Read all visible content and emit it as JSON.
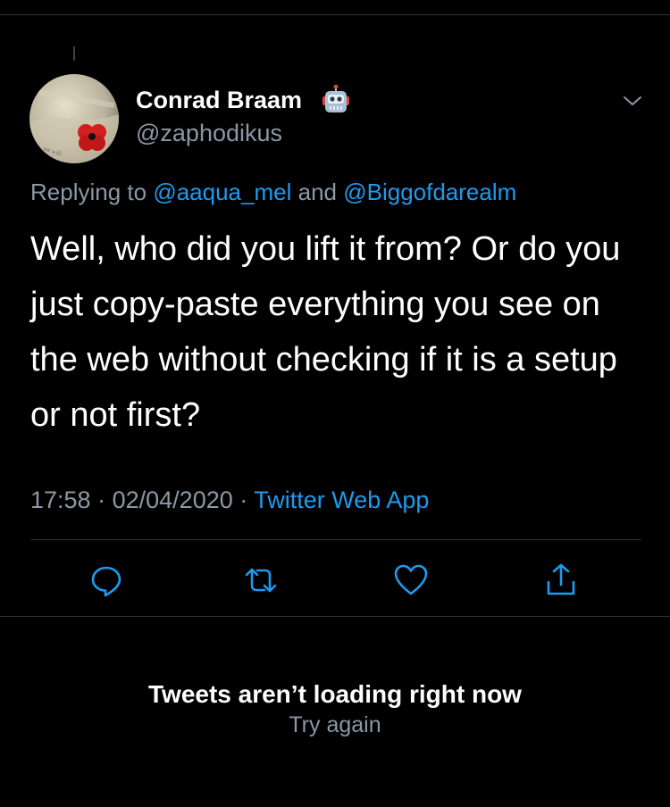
{
  "tweet": {
    "author_name": "Conrad Braam",
    "author_handle": "@zaphodikus",
    "author_badge_icon": "robot-face-icon",
    "menu_icon": "chevron-down-icon",
    "replying_prefix": "Replying to",
    "reply_mentions": [
      "@aaqua_mel",
      "@Biggofdarealm"
    ],
    "reply_conjunction": "and",
    "text": "Well, who did you lift it from? Or do you just copy-paste everything you see on the web without checking if it is a setup or not first?",
    "time": "17:58",
    "date": "02/04/2020",
    "separator": "·",
    "source": "Twitter Web App"
  },
  "actions": [
    {
      "name": "reply",
      "icon": "reply-icon"
    },
    {
      "name": "retweet",
      "icon": "retweet-icon"
    },
    {
      "name": "like",
      "icon": "heart-icon"
    },
    {
      "name": "share",
      "icon": "share-icon"
    }
  ],
  "error": {
    "title": "Tweets aren’t loading right now",
    "retry_label": "Try again"
  },
  "colors": {
    "background": "#000000",
    "primary_text": "#ffffff",
    "secondary_text": "#8b98a5",
    "accent": "#1d9bf0",
    "divider": "#2f3336"
  }
}
